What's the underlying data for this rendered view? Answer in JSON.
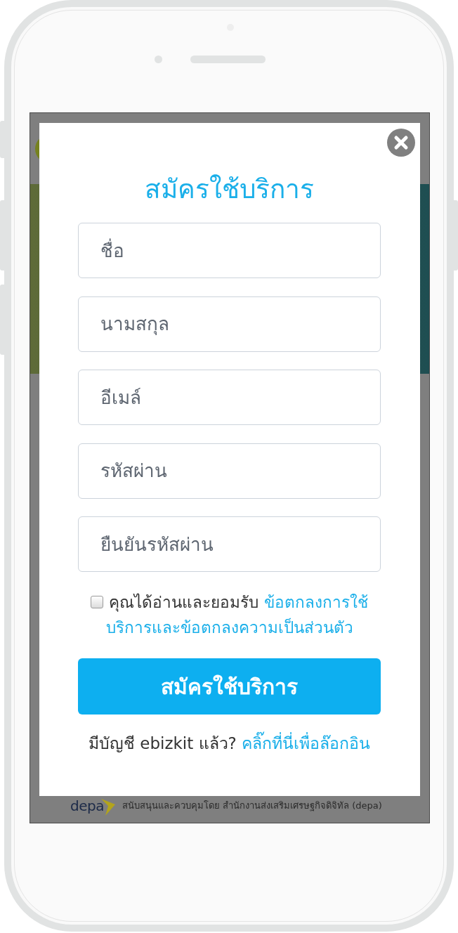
{
  "background_page": {
    "footer": {
      "logo_text": "depa",
      "text": "สนับสนุนและควบคุมโดย สำนักงานส่งเสริมเศรษฐกิจดิจิทัล (depa)"
    }
  },
  "modal": {
    "title": "สมัครใช้บริการ",
    "fields": [
      {
        "placeholder": "ชื่อ"
      },
      {
        "placeholder": "นามสกุล"
      },
      {
        "placeholder": "อีเมล์"
      },
      {
        "placeholder": "รหัสผ่าน"
      },
      {
        "placeholder": "ยืนยันรหัสผ่าน"
      }
    ],
    "terms": {
      "checked": false,
      "text": "คุณได้อ่านและยอมรับ",
      "link_lines": [
        "ข้อตกลงการใช้",
        "บริการและข้อตกลงความเป็นส่วนตัว"
      ]
    },
    "submit_button": "สมัครใช้บริการ",
    "login_prompt": {
      "text": "มีบัญชี ebizkit แล้ว?",
      "link": "คลิ๊กที่นี่เพื่อล๊อกอิน"
    }
  }
}
